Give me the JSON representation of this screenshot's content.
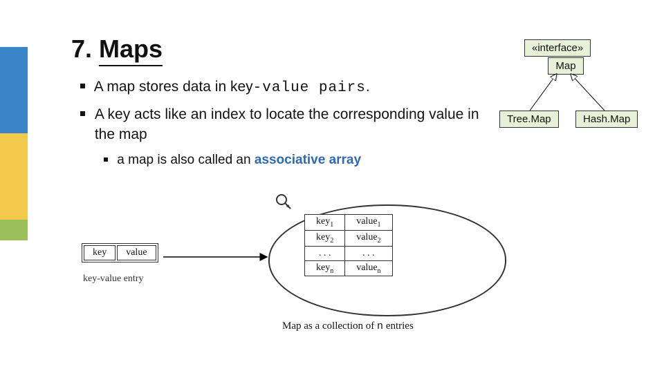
{
  "title_num": "7.",
  "title_text": "Maps",
  "bullets": {
    "b1_pre": "A map stores data in key",
    "b1_mid": "-value pairs",
    "b1_post": ".",
    "b2": "A key acts like an index to locate the corresponding value in the map",
    "b3_pre": "a map is also called an ",
    "b3_link": "associative array"
  },
  "hierarchy": {
    "interface": "«interface»",
    "map": "Map",
    "treemap": "Tree.Map",
    "hashmap": "Hash.Map"
  },
  "diagram": {
    "single_key": "key",
    "single_val": "value",
    "entry_label": "key-value entry",
    "k1": "key",
    "v1": "value",
    "k2": "key",
    "v2": "value",
    "dots": ". . .",
    "kn": "key",
    "vn": "value",
    "sub1": "1",
    "sub2": "2",
    "subn": "n",
    "caption_pre": "Map as a collection of ",
    "caption_n": "n",
    "caption_post": " entries"
  }
}
